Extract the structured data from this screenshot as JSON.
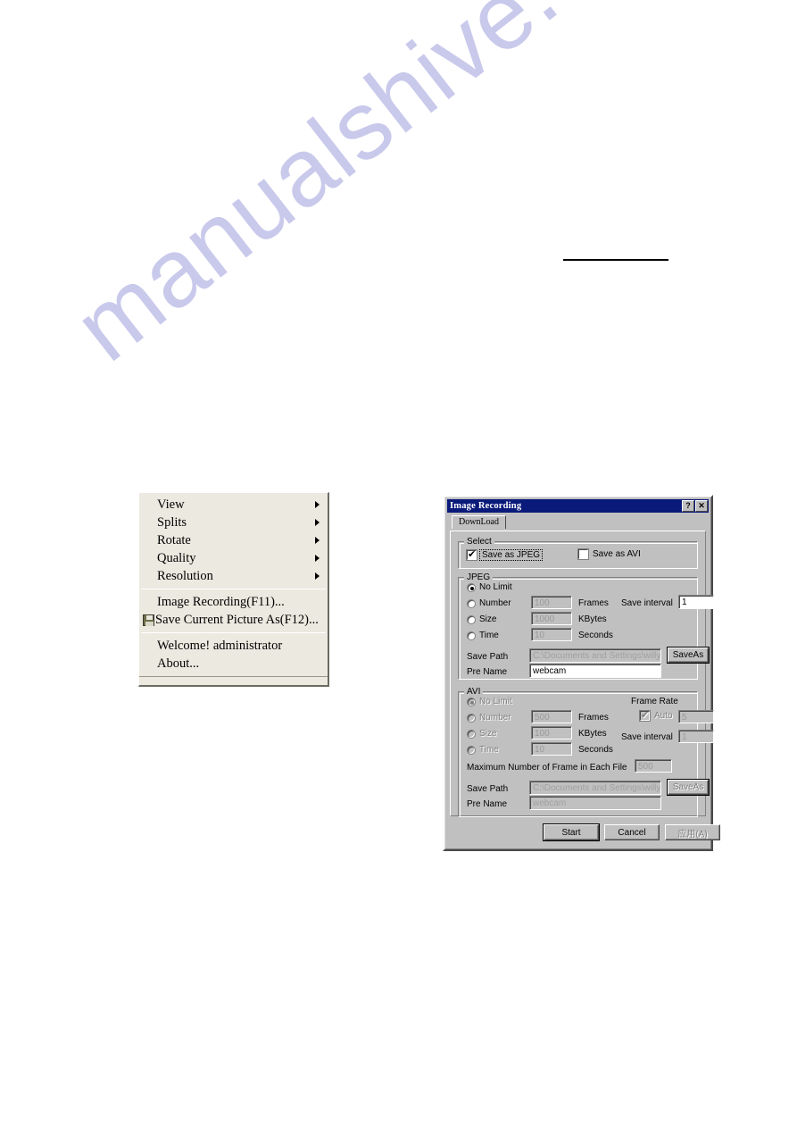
{
  "page": {
    "watermark": "manualshive.com"
  },
  "context_menu": {
    "items": [
      {
        "label": "View",
        "submenu": true
      },
      {
        "label": "Splits",
        "submenu": true
      },
      {
        "label": "Rotate",
        "submenu": true
      },
      {
        "label": "Quality",
        "submenu": true
      },
      {
        "label": "Resolution",
        "submenu": true
      }
    ],
    "group2": [
      {
        "label": "Image Recording(F11)...",
        "icon": ""
      },
      {
        "label": "Save Current Picture As(F12)...",
        "icon": "floppy-disk-icon"
      }
    ],
    "group3": [
      {
        "label": "Welcome! administrator"
      },
      {
        "label": "About..."
      }
    ]
  },
  "dialog": {
    "title": "Image Recording",
    "help_button": "?",
    "close_button": "✕",
    "tab": "DownLoad",
    "select_group": {
      "title": "Select",
      "save_as_jpeg": {
        "label": "Save as JPEG",
        "checked": true
      },
      "save_as_avi": {
        "label": "Save as AVI",
        "checked": false
      }
    },
    "jpeg_group": {
      "title": "JPEG",
      "no_limit_label": "No Limit",
      "number_label": "Number",
      "number_value": "100",
      "number_unit": "Frames",
      "size_label": "Size",
      "size_value": "1000",
      "size_unit": "KBytes",
      "time_label": "Time",
      "time_value": "10",
      "time_unit": "Seconds",
      "save_interval_label": "Save interval",
      "save_interval_value": "1",
      "save_path_label": "Save Path",
      "save_path_value": "C:\\Documents and Settings\\willyliu\\",
      "save_as_button": "SaveAs",
      "pre_name_label": "Pre Name",
      "pre_name_value": "webcam"
    },
    "avi_group": {
      "title": "AVI",
      "no_limit_label": "No Limit",
      "number_label": "Number",
      "number_value": "500",
      "number_unit": "Frames",
      "size_label": "Size",
      "size_value": "100",
      "size_unit": "KBytes",
      "time_label": "Time",
      "time_value": "10",
      "time_unit": "Seconds",
      "frame_rate_label": "Frame Rate",
      "auto_label": "Auto",
      "auto_checked": true,
      "frame_rate_value": "5",
      "save_interval_label": "Save interval",
      "save_interval_value": "1",
      "max_frame_label": "Maximum Number of Frame in Each File",
      "max_frame_value": "500",
      "save_path_label": "Save Path",
      "save_path_value": "C:\\Documents and Settings\\willyliu\\",
      "save_as_button": "SaveAs",
      "pre_name_label": "Pre Name",
      "pre_name_value": "webcam"
    },
    "buttons": {
      "start": "Start",
      "cancel": "Cancel",
      "apply": "应用(A)"
    }
  }
}
